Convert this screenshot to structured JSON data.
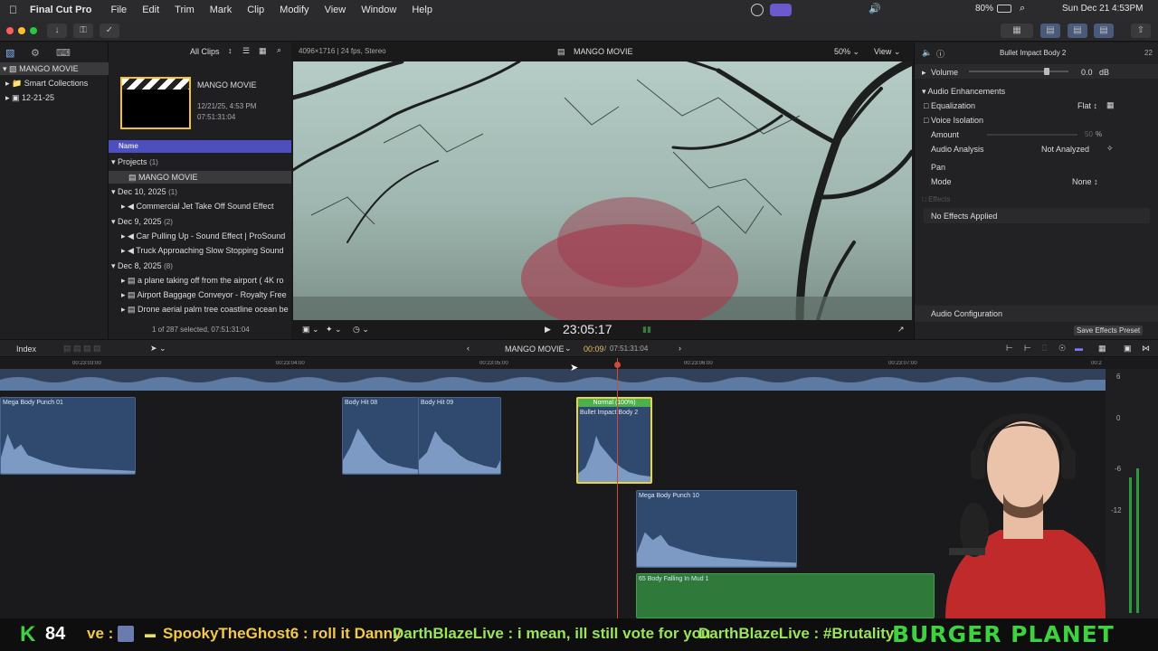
{
  "menubar": {
    "app": "Final Cut Pro",
    "items": [
      "File",
      "Edit",
      "Trim",
      "Mark",
      "Clip",
      "Modify",
      "View",
      "Window",
      "Help"
    ],
    "battery": "80%",
    "datetime": "Sun Dec 21  4:53PM"
  },
  "library": {
    "root": "MANGO MOVIE",
    "items": [
      "Smart Collections",
      "12-21-25"
    ]
  },
  "browser": {
    "filter": "All Clips",
    "project_title": "MANGO MOVIE",
    "project_date": "12/21/25, 4:53 PM",
    "project_duration": "07:51:31:04",
    "column_name": "Name",
    "groups": [
      {
        "label": "Projects",
        "count": "(1)",
        "items": [
          "MANGO MOVIE"
        ]
      },
      {
        "label": "Dec 10, 2025",
        "count": "(1)",
        "items": [
          "Commercial Jet Take Off Sound Effect"
        ]
      },
      {
        "label": "Dec 9, 2025",
        "count": "(2)",
        "items": [
          "Car Pulling Up - Sound Effect  |  ProSound",
          "Truck Approaching Slow Stopping Sound"
        ]
      },
      {
        "label": "Dec 8, 2025",
        "count": "(8)",
        "items": [
          "a plane taking off from the airport ( 4K ro",
          "Airport Baggage Conveyor - Royalty Free",
          "Drone aerial palm tree coastline ocean be"
        ]
      }
    ],
    "selection": "1 of 287 selected, 07:51:31:04"
  },
  "viewer": {
    "format": "4096×1716 | 24 fps, Stereo",
    "title": "MANGO MOVIE",
    "zoom": "50%",
    "view": "View",
    "timecode": "23:05:17"
  },
  "inspector": {
    "clip": "Bullet Impact Body 2",
    "clip_tc": "22",
    "volume_label": "Volume",
    "volume_value": "0.0",
    "volume_unit": "dB",
    "volume_level": 0.78,
    "enh_title": "Audio Enhancements",
    "equalization": "Equalization",
    "eq_value": "Flat",
    "voice_isolation": "Voice Isolation",
    "amount": "Amount",
    "amount_value": "50",
    "amount_unit": "%",
    "analysis": "Audio Analysis",
    "analysis_value": "Not Analyzed",
    "pan": "Pan",
    "mode": "Mode",
    "mode_value": "None",
    "effects": "Effects",
    "no_effects": "No Effects Applied",
    "config": "Audio Configuration",
    "save_preset": "Save Effects Preset"
  },
  "timeline": {
    "index": "Index",
    "project": "MANGO MOVIE",
    "position": "00:09",
    "duration": "07:51:31:04",
    "ruler": [
      "00:23:03:00",
      "00:23:04:00",
      "00:23:05:00",
      "00:23:06:00",
      "00:23:07:00",
      "00:2"
    ],
    "meter": [
      "6",
      "0",
      "-6",
      "-12"
    ],
    "clips": [
      {
        "name": "Mega Body Punch 01"
      },
      {
        "name": "Body Hit 08"
      },
      {
        "name": "Body Hit 09"
      },
      {
        "name": "Bullet Impact Body 2",
        "badge": "Normal (100%)"
      },
      {
        "name": "Mega Body Punch 10"
      },
      {
        "name": "65 Body Falling In Mud 1"
      }
    ]
  },
  "ticker": {
    "level": "84",
    "messages": [
      "ve :",
      "SpookyTheGhost6 : roll it Danny",
      "DarthBlazeLive : i mean, ill still vote for you",
      "DarthBlazeLive : #Brutality"
    ],
    "brand": "BURGER PLANET"
  }
}
